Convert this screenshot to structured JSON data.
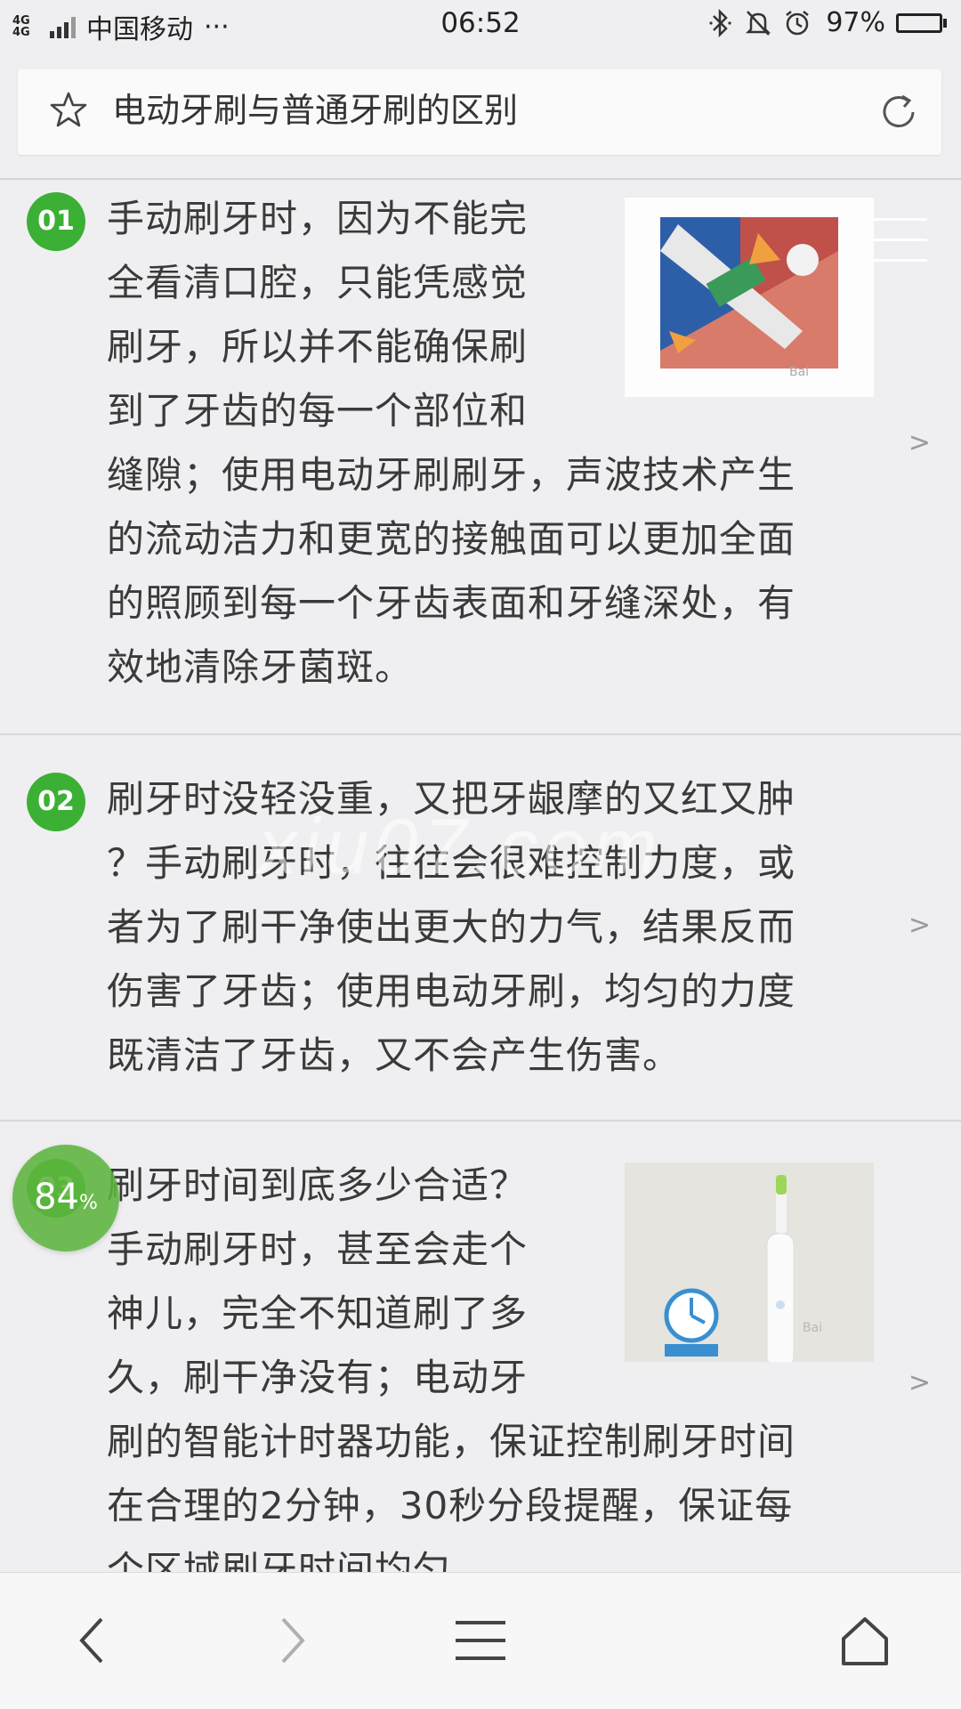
{
  "status_bar": {
    "network": "4G 4G",
    "carrier": "中国移动",
    "more": "···",
    "time": "06:52",
    "battery": "97%",
    "battery_level": 0.97,
    "icons": [
      "bluetooth-icon",
      "bell-muted-icon",
      "alarm-icon",
      "battery-icon"
    ]
  },
  "address_bar": {
    "title": "电动牙刷与普通牙刷的区别",
    "icons": [
      "star-icon",
      "reload-icon"
    ]
  },
  "steps": [
    {
      "number": "01",
      "lines": [
        "手动刷牙时，因为不能完",
        "全看清口腔，只能凭感觉",
        "刷牙，所以并不能确保刷",
        "到了牙齿的每一个部位和",
        "缝隙；使用电动牙刷刷牙，声波技术产生",
        "的流动洁力和更宽的接触面可以更加全面",
        "的照顾到每一个牙齿表面和牙缝深处，有",
        "效地清除牙菌斑。"
      ],
      "chevron": ">"
    },
    {
      "number": "02",
      "lines": [
        "刷牙时没轻没重，又把牙龈摩的又红又肿",
        "？手动刷牙时，往往会很难控制力度，或",
        "者为了刷干净使出更大的力气，结果反而",
        "伤害了牙齿；使用电动牙刷，均匀的力度",
        "既清洁了牙齿，又不会产生伤害。"
      ],
      "chevron": ">"
    },
    {
      "number": "03",
      "lines": [
        "刷牙时间到底多少合适？",
        "手动刷牙时，甚至会走个",
        "神儿，完全不知道刷了多",
        "久，刷干净没有；电动牙",
        "刷的智能计时器功能，保证控制刷牙时间",
        "在合理的2分钟，30秒分段提醒，保证每",
        "个区域刷牙时间均匀。"
      ],
      "chevron": ">"
    }
  ],
  "watermark": "xiu07.com",
  "progress": {
    "value": "84",
    "unit": "%",
    "fraction": 0.84
  },
  "bottom_bar": {
    "tab_count": "1",
    "icons": [
      "back-icon",
      "forward-icon",
      "menu-icon",
      "tabs-icon",
      "home-icon"
    ]
  }
}
